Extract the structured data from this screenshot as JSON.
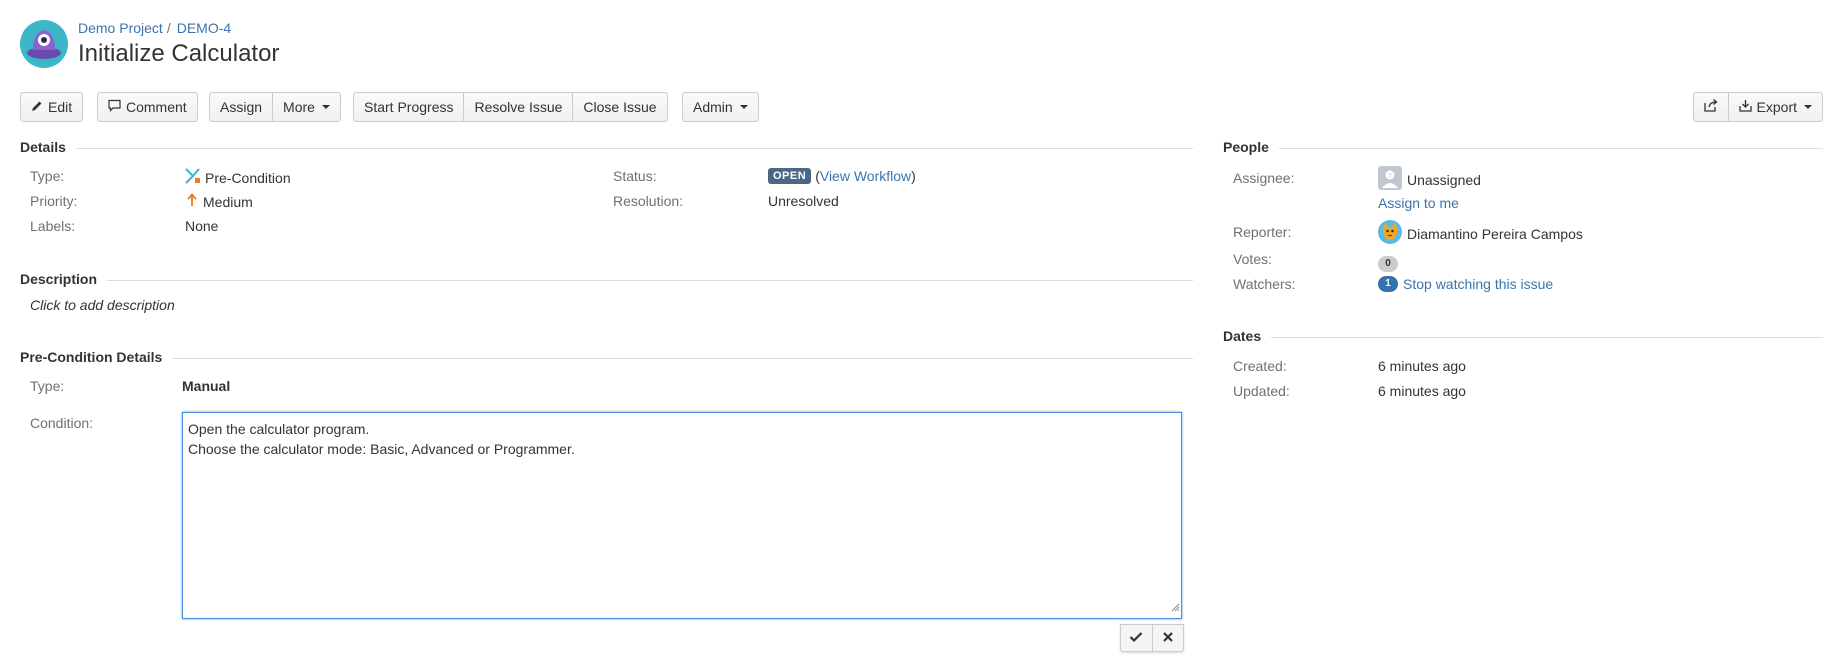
{
  "header": {
    "project_link": "Demo Project",
    "separator": "/",
    "issue_key": "DEMO-4",
    "title": "Initialize Calculator"
  },
  "toolbar": {
    "edit": "Edit",
    "comment": "Comment",
    "assign": "Assign",
    "more": "More",
    "start_progress": "Start Progress",
    "resolve_issue": "Resolve Issue",
    "close_issue": "Close Issue",
    "admin": "Admin",
    "export": "Export"
  },
  "details": {
    "heading": "Details",
    "type_label": "Type:",
    "type_value": "Pre-Condition",
    "priority_label": "Priority:",
    "priority_value": "Medium",
    "labels_label": "Labels:",
    "labels_value": "None",
    "status_label": "Status:",
    "status_value": "OPEN",
    "workflow_open": "(",
    "workflow_link": "View Workflow",
    "workflow_close": ")",
    "resolution_label": "Resolution:",
    "resolution_value": "Unresolved"
  },
  "description": {
    "heading": "Description",
    "placeholder": "Click to add description"
  },
  "precondition": {
    "heading": "Pre-Condition Details",
    "type_label": "Type:",
    "type_value": "Manual",
    "condition_label": "Condition:",
    "condition_line1": "Open the calculator program.",
    "condition_line2": "Choose the calculator mode: Basic, Advanced or Programmer."
  },
  "people": {
    "heading": "People",
    "assignee_label": "Assignee:",
    "assignee_value": "Unassigned",
    "assign_to_me": "Assign to me",
    "reporter_label": "Reporter:",
    "reporter_value": "Diamantino Pereira Campos",
    "votes_label": "Votes:",
    "votes_count": "0",
    "watchers_label": "Watchers:",
    "watchers_count": "1",
    "stop_watching": "Stop watching this issue"
  },
  "dates": {
    "heading": "Dates",
    "created_label": "Created:",
    "created_value": "6 minutes ago",
    "updated_label": "Updated:",
    "updated_value": "6 minutes ago"
  },
  "colors": {
    "link": "#3b73af",
    "status_badge": "#4a6785",
    "watch_badge": "#3572b0",
    "focus_border": "#4a90d9",
    "priority_medium": "#e67e22"
  }
}
